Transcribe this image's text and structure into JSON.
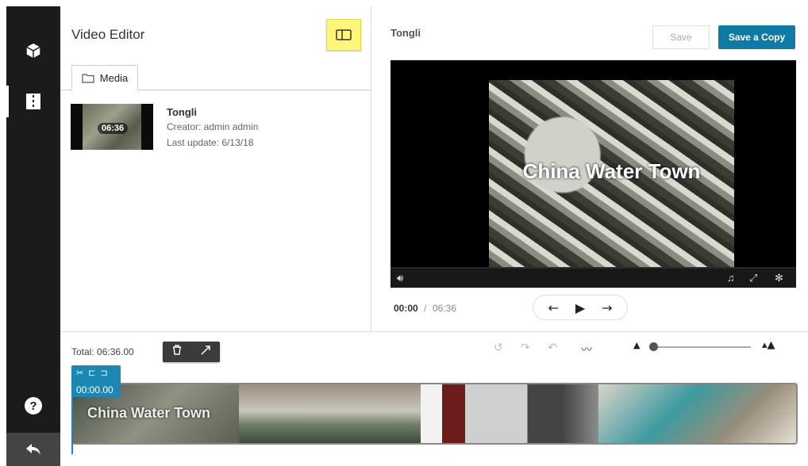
{
  "sidebar": {
    "help_label": "?",
    "icons": [
      "cube-icon",
      "editor-layout-icon",
      "help-icon",
      "back-arrow-icon"
    ]
  },
  "header": {
    "title": "Video Editor"
  },
  "media_tab": {
    "label": "Media"
  },
  "media_item": {
    "name": "Tongli",
    "duration": "06:36",
    "creator": "Creator: admin admin",
    "last_update": "Last update: 6/13/18"
  },
  "preview": {
    "entry_title": "Tongli",
    "save_label": "Save",
    "save_copy_label": "Save a Copy",
    "overlay_text": "China Water Town",
    "current_time": "00:00",
    "separator": "/",
    "total_time": "06:36"
  },
  "timeline": {
    "total_label": "Total: 06:36.00",
    "playhead_time": "00:00.00",
    "strip_text": "China Water Town",
    "zoom_level": 0.0
  },
  "colors": {
    "accent": "#0e7ba6",
    "playhead": "#1a88b3",
    "highlight": "#fff67a",
    "sidebar": "#1b1b1b"
  }
}
